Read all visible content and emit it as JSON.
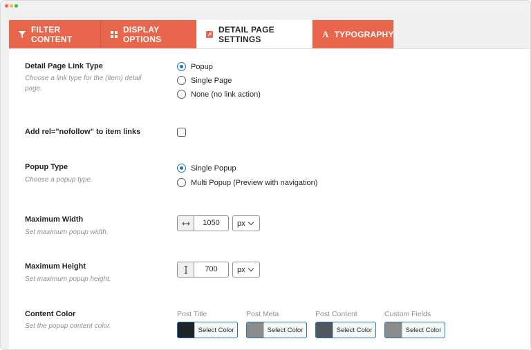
{
  "tabs": [
    {
      "label": "FILTER CONTENT",
      "icon": "filter-icon"
    },
    {
      "label": "DISPLAY OPTIONS",
      "icon": "grid-icon"
    },
    {
      "label": "DETAIL PAGE SETTINGS",
      "icon": "external-link-icon"
    },
    {
      "label": "TYPOGRAPHY",
      "icon": "font-icon"
    }
  ],
  "accent_color": "#e8664c",
  "link_type": {
    "label": "Detail Page Link Type",
    "desc": "Choose a link type for the (item) detail page.",
    "options": [
      "Popup",
      "Single Page",
      "None (no link action)"
    ],
    "selected": "Popup"
  },
  "nofollow": {
    "label": "Add rel=\"nofollow\" to item links",
    "checked": false
  },
  "popup_type": {
    "label": "Popup Type",
    "desc": "Choose a popup type.",
    "options": [
      "Single Popup",
      "Multi Popup (Preview with navigation)"
    ],
    "selected": "Single Popup"
  },
  "max_width": {
    "label": "Maximum Width",
    "desc": "Set maximum popup width.",
    "value": "1050",
    "unit": "px",
    "icon": "horizontal-arrows-icon"
  },
  "max_height": {
    "label": "Maximum Height",
    "desc": "Set maximum popup height.",
    "value": "700",
    "unit": "px",
    "icon": "vertical-arrows-icon"
  },
  "content_color": {
    "label": "Content Color",
    "desc": "Set the popup content color.",
    "button_label": "Select Color",
    "items": [
      {
        "label": "Post Title",
        "color": "#1d2327"
      },
      {
        "label": "Post Meta",
        "color": "#8c8c8c"
      },
      {
        "label": "Post Content",
        "color": "#50575e"
      },
      {
        "label": "Custom Fields",
        "color": "#8c8c8c"
      }
    ]
  }
}
